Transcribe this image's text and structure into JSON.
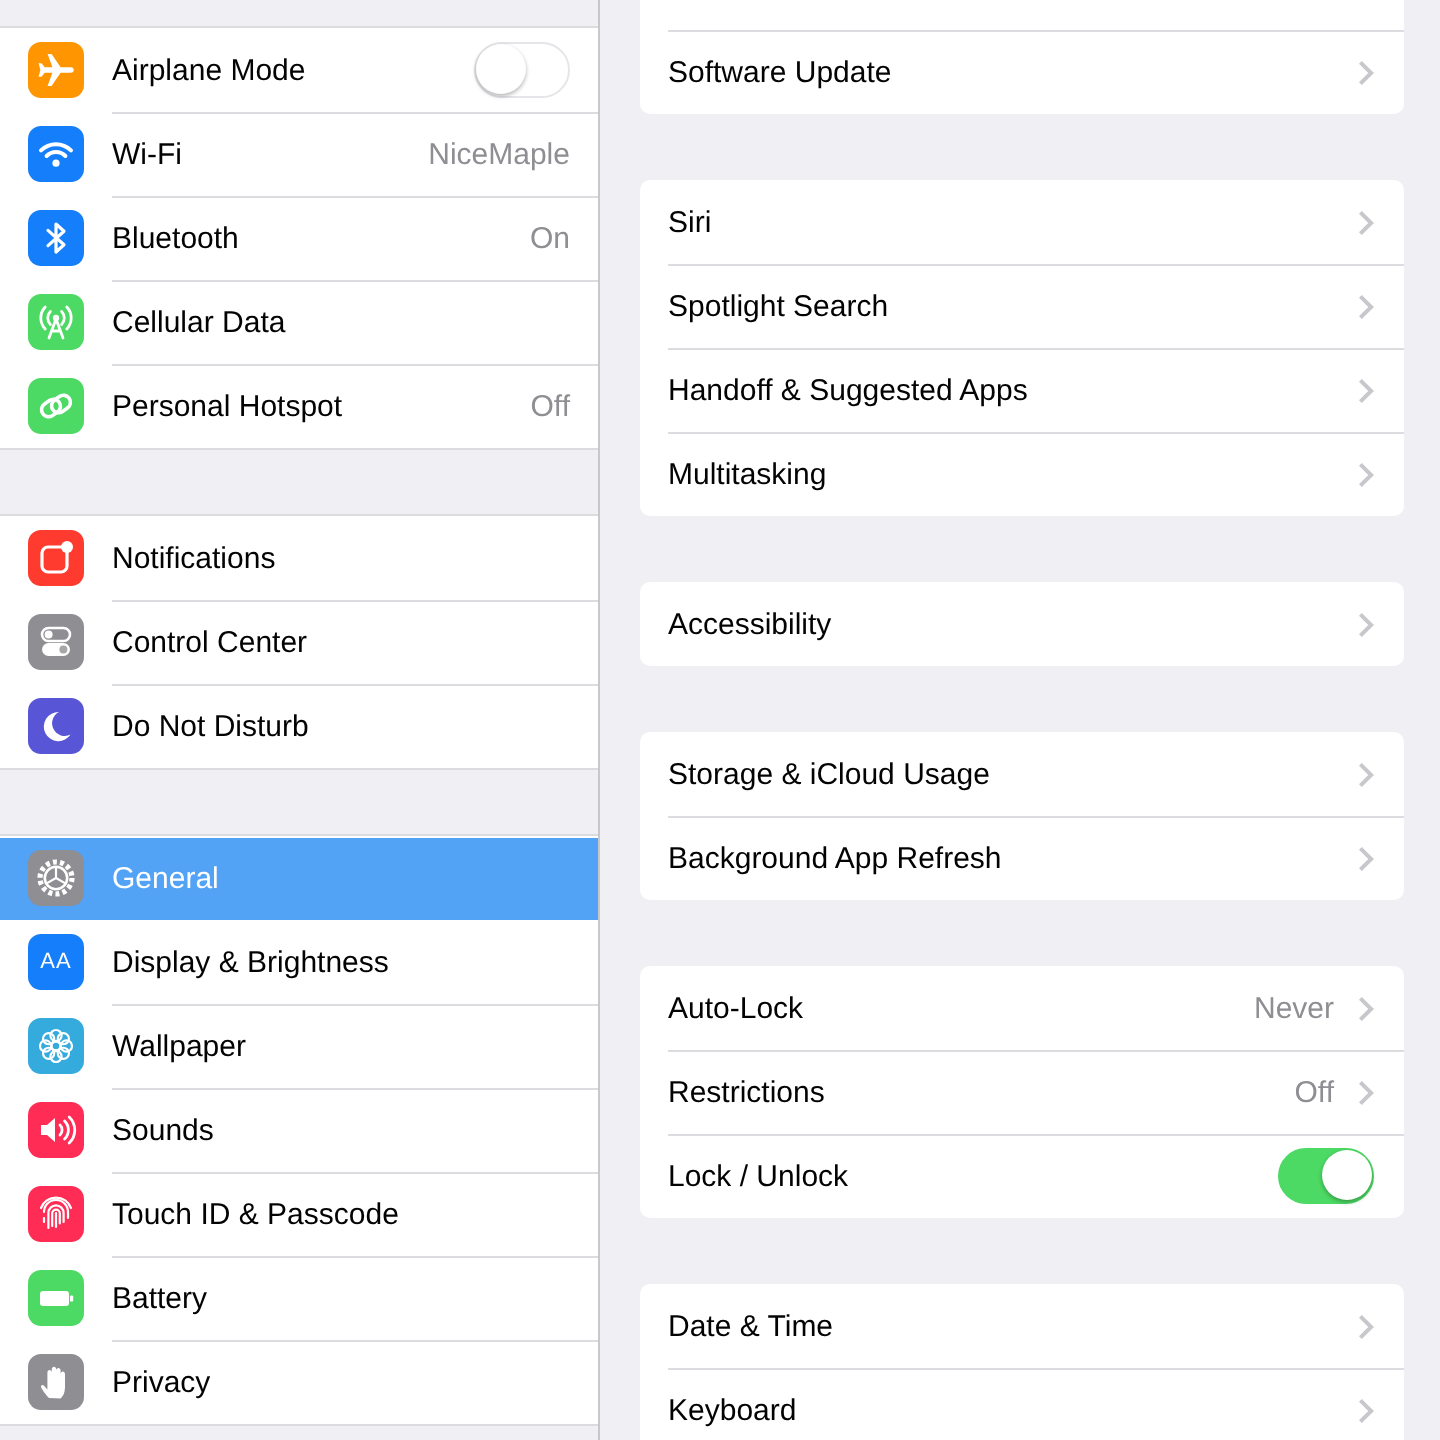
{
  "sidebar": {
    "groups": [
      {
        "items": [
          {
            "label": "Airplane Mode",
            "color": "#ff9500",
            "kind": "toggle",
            "on": false,
            "selected": false
          },
          {
            "label": "Wi-Fi",
            "color": "#147efb",
            "kind": "item",
            "value": "NiceMaple",
            "selected": false
          },
          {
            "label": "Bluetooth",
            "color": "#147efb",
            "kind": "item",
            "value": "On",
            "selected": false
          },
          {
            "label": "Cellular Data",
            "color": "#4cd964",
            "kind": "item",
            "selected": false
          },
          {
            "label": "Personal Hotspot",
            "color": "#4cd964",
            "kind": "item",
            "value": "Off",
            "selected": false
          }
        ]
      },
      {
        "items": [
          {
            "label": "Notifications",
            "color": "#ff3b30",
            "kind": "item",
            "selected": false
          },
          {
            "label": "Control Center",
            "color": "#8e8e93",
            "kind": "item",
            "selected": false
          },
          {
            "label": "Do Not Disturb",
            "color": "#5856d6",
            "kind": "item",
            "selected": false
          }
        ]
      },
      {
        "items": [
          {
            "label": "General",
            "color": "#8e8e93",
            "kind": "item",
            "selected": true
          },
          {
            "label": "Display & Brightness",
            "color": "#147efb",
            "icon_text": "AA",
            "kind": "item",
            "selected": false
          },
          {
            "label": "Wallpaper",
            "color": "#35aadc",
            "kind": "item",
            "selected": false
          },
          {
            "label": "Sounds",
            "color": "#ff2d55",
            "kind": "item",
            "selected": false
          },
          {
            "label": "Touch ID & Passcode",
            "color": "#ff2d55",
            "kind": "item",
            "selected": false
          },
          {
            "label": "Battery",
            "color": "#4cd964",
            "kind": "item",
            "selected": false
          },
          {
            "label": "Privacy",
            "color": "#8e8e93",
            "kind": "item",
            "selected": false
          }
        ]
      }
    ]
  },
  "detail": {
    "groups": [
      {
        "rows": [
          {
            "label": "Software Update",
            "kind": "link"
          }
        ]
      },
      {
        "rows": [
          {
            "label": "Siri",
            "kind": "link"
          },
          {
            "label": "Spotlight Search",
            "kind": "link"
          },
          {
            "label": "Handoff & Suggested Apps",
            "kind": "link"
          },
          {
            "label": "Multitasking",
            "kind": "link"
          }
        ]
      },
      {
        "rows": [
          {
            "label": "Accessibility",
            "kind": "link"
          }
        ]
      },
      {
        "rows": [
          {
            "label": "Storage & iCloud Usage",
            "kind": "link"
          },
          {
            "label": "Background App Refresh",
            "kind": "link"
          }
        ]
      },
      {
        "rows": [
          {
            "label": "Auto-Lock",
            "kind": "link",
            "value": "Never"
          },
          {
            "label": "Restrictions",
            "kind": "link",
            "value": "Off"
          },
          {
            "label": "Lock / Unlock",
            "kind": "toggle",
            "on": true
          }
        ]
      },
      {
        "rows": [
          {
            "label": "Date & Time",
            "kind": "link"
          },
          {
            "label": "Keyboard",
            "kind": "link"
          }
        ]
      }
    ]
  }
}
